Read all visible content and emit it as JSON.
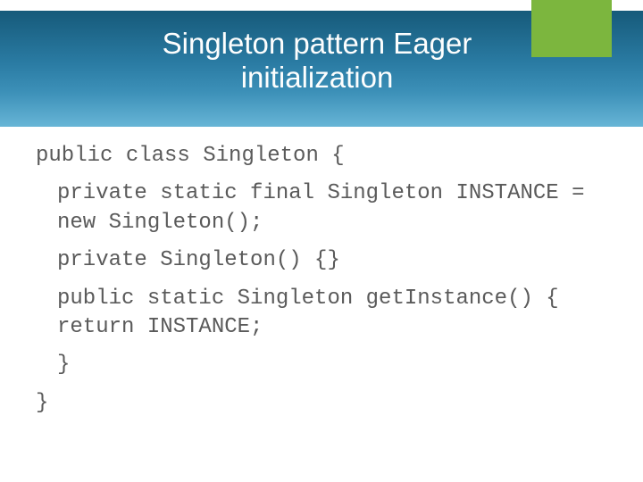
{
  "title": "Singleton pattern Eager initialization",
  "code": {
    "line1": "public class Singleton {",
    "line2": "private static final Singleton INSTANCE = new Singleton();",
    "line3": "private Singleton() {}",
    "line4": "public static Singleton getInstance() { return INSTANCE;",
    "line5": "}",
    "line6": "}"
  },
  "colors": {
    "accent": "#7cb63e",
    "titlebar_start": "#165a7a",
    "titlebar_end": "#67b5d6",
    "code_text": "#5a5a5a"
  }
}
